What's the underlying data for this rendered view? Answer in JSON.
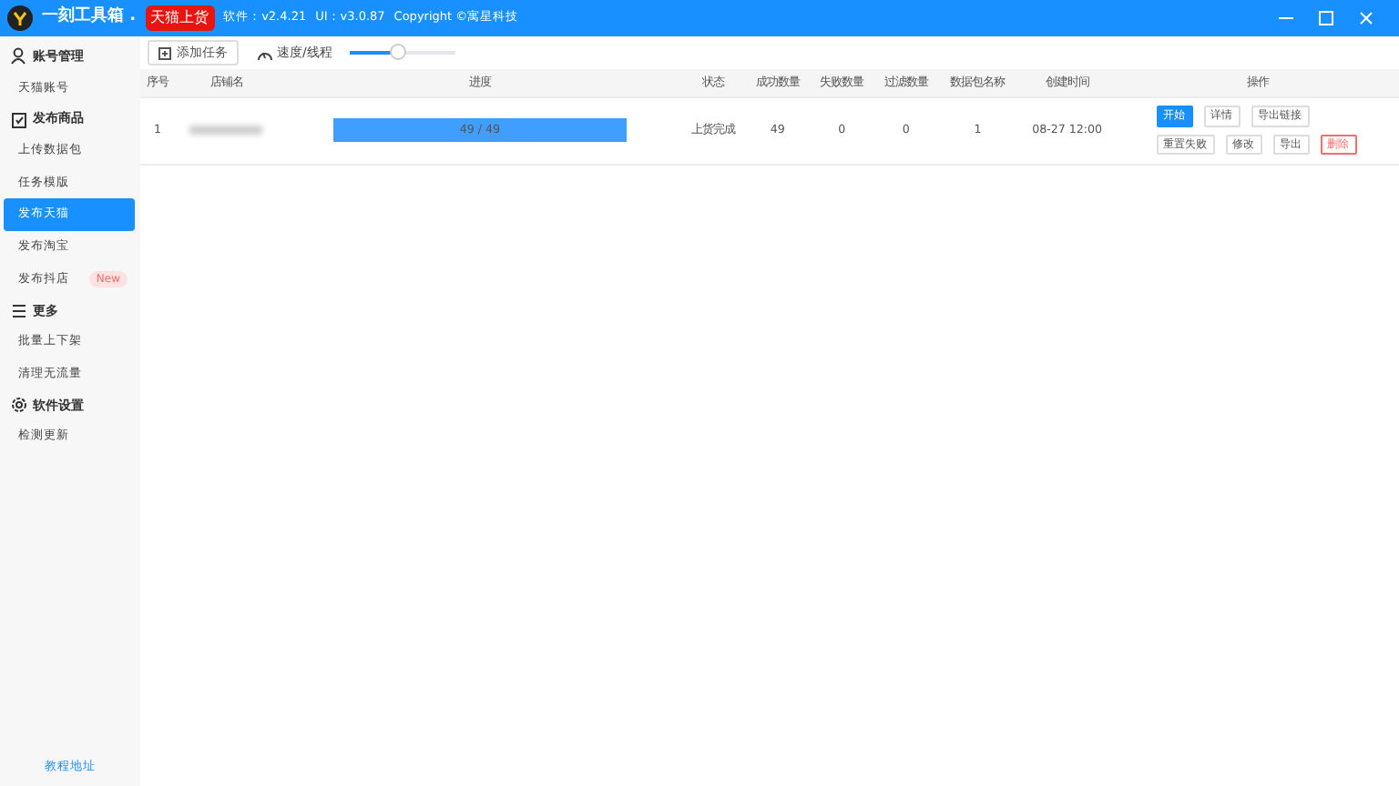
{
  "titlebar": {
    "app_name": "一刻工具箱 .",
    "tag": "天猫上货",
    "software_version": "软件：v2.4.21",
    "ui_version": "UI：v3.0.87",
    "copyright": "Copyright ©寓星科技"
  },
  "sidebar": {
    "groups": [
      {
        "kind": "person",
        "label": "账号管理",
        "items": [
          {
            "label": "天猫账号",
            "selected": false
          }
        ]
      },
      {
        "kind": "clipboard",
        "label": "发布商品",
        "items": [
          {
            "label": "上传数据包",
            "selected": false
          },
          {
            "label": "任务模版",
            "selected": false
          },
          {
            "label": "发布天猫",
            "selected": true
          },
          {
            "label": "发布淘宝",
            "selected": false
          },
          {
            "label": "发布抖店",
            "selected": false,
            "badge": "New"
          }
        ]
      },
      {
        "kind": "menu",
        "label": "更多",
        "items": [
          {
            "label": "批量上下架",
            "selected": false
          },
          {
            "label": "清理无流量",
            "selected": false
          }
        ]
      },
      {
        "kind": "gear",
        "label": "软件设置",
        "items": [
          {
            "label": "检测更新",
            "selected": false
          }
        ]
      }
    ],
    "footer_link": "教程地址"
  },
  "toolbar": {
    "add_button": "添加任务",
    "speed_label": "速度/线程",
    "speed": {
      "level": 0.45
    }
  },
  "table": {
    "columns": [
      "序号",
      "店铺名",
      "进度",
      "状态",
      "成功数量",
      "失败数量",
      "过滤数量",
      "数据包名称",
      "创建时间",
      "操作"
    ],
    "rows": [
      {
        "index": "1",
        "progress": {
          "level": 1,
          "text": "49 / 49"
        },
        "status": "上货完成",
        "success": "49",
        "failed": "0",
        "filtered": "0",
        "package": "1",
        "created": "08-27 12:00",
        "actions": [
          {
            "label": "开始",
            "kind": "primary"
          },
          {
            "label": "详情",
            "kind": "default"
          },
          {
            "label": "导出链接",
            "kind": "default"
          },
          {
            "label": "重置失败",
            "kind": "default"
          },
          {
            "label": "修改",
            "kind": "default"
          },
          {
            "label": "导出",
            "kind": "default"
          },
          {
            "label": "删除",
            "kind": "danger"
          }
        ]
      }
    ]
  }
}
